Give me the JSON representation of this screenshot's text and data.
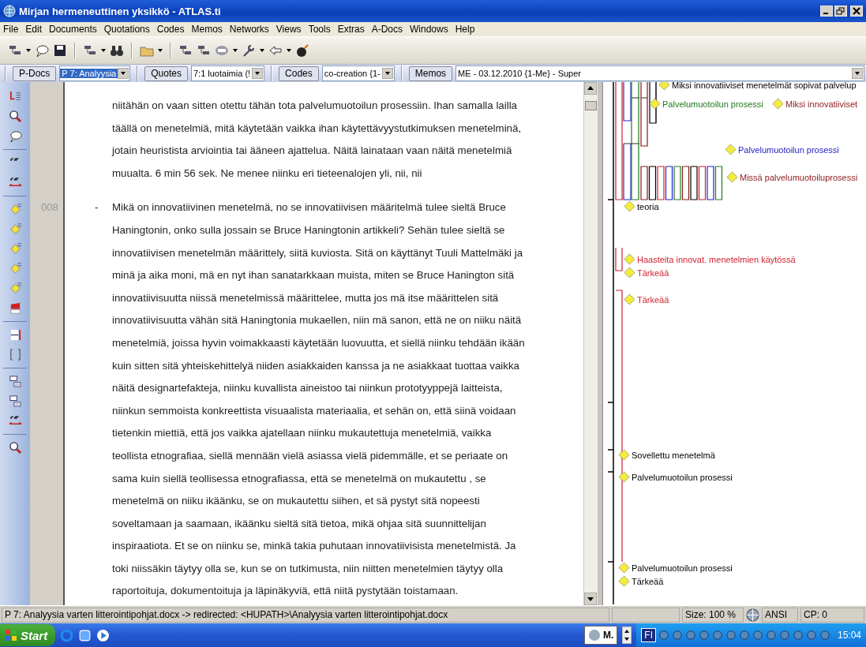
{
  "window": {
    "title": "Mirjan hermeneuttinen yksikkö - ATLAS.ti"
  },
  "menu": [
    "File",
    "Edit",
    "Documents",
    "Quotations",
    "Codes",
    "Memos",
    "Networks",
    "Views",
    "Tools",
    "Extras",
    "A-Docs",
    "Windows",
    "Help"
  ],
  "object_bar": [
    {
      "kind": "button",
      "label": "P-Docs"
    },
    {
      "kind": "combo",
      "value": "P 7: Analyysia",
      "selected": true
    },
    {
      "kind": "button",
      "label": "Quotes"
    },
    {
      "kind": "combo",
      "value": "7:1 luotaimia (!",
      "selected": false
    },
    {
      "kind": "button",
      "label": "Codes"
    },
    {
      "kind": "combo",
      "value": "co-creation {1-",
      "selected": false
    },
    {
      "kind": "button",
      "label": "Memos"
    },
    {
      "kind": "combo",
      "value": "ME - 03.12.2010 {1-Me} - Super",
      "selected": false,
      "wide": true
    }
  ],
  "document": {
    "paragraphs": [
      {
        "lines": [
          "niitähän on vaan sitten otettu tähän tota palvelumuotoilun prosessiin. Ihan samalla lailla",
          "täällä on menetelmiä, mitä käytetään vaikka ihan käytettävyystutkimuksen menetelminä,",
          "jotain heuristista arviointia tai ääneen ajattelua. Näitä lainataan vaan näitä menetelmiä",
          "muualta. 6 min 56 sek. Ne menee niinku eri tieteenalojen yli, nii, nii"
        ]
      },
      {
        "number": "008",
        "bullet": "-",
        "lines": [
          "Mikä on innovatiivinen menetelmä, no se innovatiivisen määritelmä tulee sieltä Bruce",
          "Haningtonin, onko sulla jossain se Bruce Haningtonin artikkeli? Sehän tulee sieltä se",
          "innovatiivisen menetelmän määrittely, siitä kuviosta. Sitä on käyttänyt Tuuli Mattelmäki ja",
          "minä ja aika moni, mä en nyt ihan sanatarkkaan muista, miten se Bruce Hanington sitä",
          "innovatiivisuutta niissä menetelmissä määrittelee, mutta jos mä itse määrittelen sitä",
          "innovatiivisuutta vähän sitä Haningtonia mukaellen, niin mä sanon, että ne on niiku näitä",
          "menetelmiä, joissa hyvin voimakkaasti käytetään luovuutta, et siellä niinku tehdään ikään",
          "kuin sitten sitä yhteiskehittelyä niiden asiakkaiden kanssa ja ne asiakkaat tuottaa vaikka",
          "näitä designartefakteja, niinku kuvallista aineistoo tai niinkun prototyyppejä laitteista,",
          "niinkun semmoista konkreettista visuaalista materiaalia, et sehän on, että siinä voidaan",
          "tietenkin miettiä, että jos vaikka ajatellaan niinku mukautettuja menetelmiä, vaikka",
          "teollista etnografiaa, siellä mennään vielä asiassa vielä pidemmälle, et se periaate on",
          "sama kuin siellä teollisessa etnografiassa, että se menetelmä on mukautettu , se",
          "menetelmä on niiku ikäänku, se on mukautettu siihen, et sä pystyt sitä nopeesti",
          "soveltamaan ja saamaan, ikäänku sieltä sitä tietoa, mikä ohjaa sitä suunnittelijan",
          "inspiraatiota. Et se on niinku se, minkä takia puhutaan innovatiivisista menetelmistä. Ja",
          "toki niissäkin täytyy olla se, kun se on tutkimusta, niin niitten menetelmien täytyy olla",
          "raportoituja, dokumentoituja ja läpinäkyviä, että niitä pystytään toistamaan."
        ]
      }
    ]
  },
  "margin": {
    "codes": [
      {
        "label": "Miksi innovatiiviset menetelmät sopivat palvelup",
        "color": "#000000"
      },
      {
        "label": "Palvelumuotoilun prosessi",
        "color": "#1e7b1e"
      },
      {
        "label": "Miksi innovatiiviset",
        "color": "#8b1a1a"
      },
      {
        "label": "Palvelumuotoilun prosessi",
        "color": "#2323c8"
      },
      {
        "label": "Missä palvelumuotoiluprosessi",
        "color": "#8b1a1a"
      },
      {
        "label": "teoria",
        "color": "#000000"
      },
      {
        "label": "Haasteita innovat. menetelmien käytössä",
        "color": "#d01f2a"
      },
      {
        "label": "Tärkeää",
        "color": "#d01f2a"
      },
      {
        "label": "Tärkeää",
        "color": "#d01f2a"
      },
      {
        "label": "Sovellettu menetelmä",
        "color": "#000000"
      },
      {
        "label": "Palvelumuotoilun prosessi",
        "color": "#000000"
      },
      {
        "label": "Palvelumuotoilun prosessi",
        "color": "#000000"
      },
      {
        "label": "Tärkeää",
        "color": "#000000"
      }
    ]
  },
  "status_bar": {
    "path": "P 7: Analyysia varten litterointipohjat.docx -> redirected: <HUPATH>\\Analyysia varten litterointipohjat.docx",
    "size": "Size: 100 %",
    "encoding": "ANSI",
    "cp": "CP: 0"
  },
  "taskbar": {
    "start": "Start",
    "tray_label": "M.",
    "language": "FI",
    "clock": "15:04"
  }
}
